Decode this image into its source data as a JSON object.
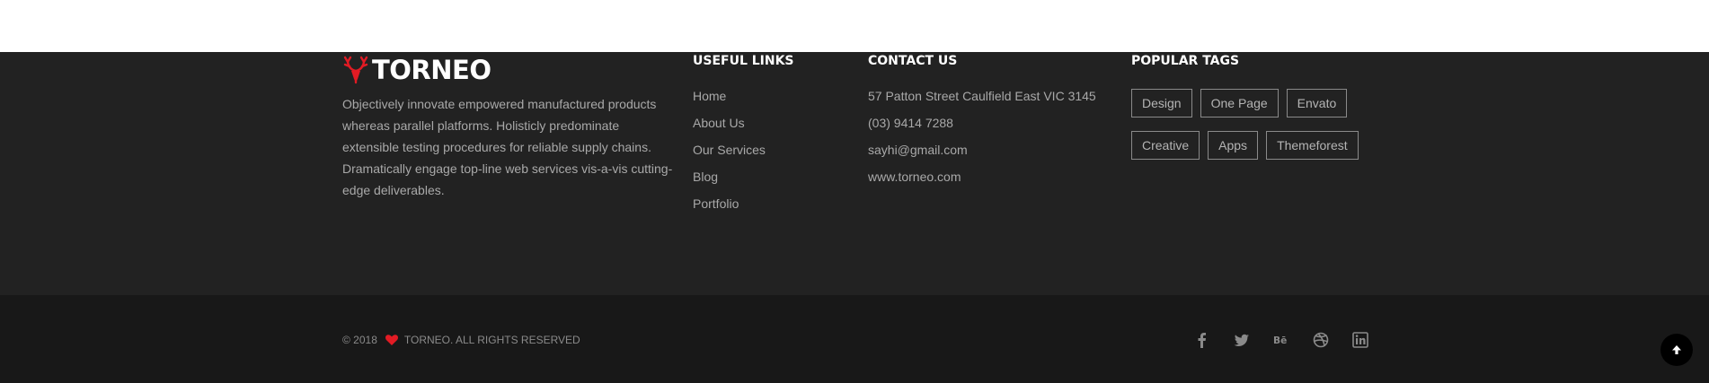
{
  "brand": {
    "name": "TORNEO",
    "accent": "#e21b24"
  },
  "about": {
    "text": "Objectively innovate empowered manufactured products whereas parallel platforms. Holisticly predominate extensible testing procedures for reliable supply chains. Dramatically engage top-line web services vis-a-vis cutting-edge deliverables."
  },
  "useful_links": {
    "title": "USEFUL LINKS",
    "items": [
      "Home",
      "About Us",
      "Our Services",
      "Blog",
      "Portfolio"
    ]
  },
  "contact": {
    "title": "CONTACT US",
    "address": "57 Patton Street Caulfield East VIC 3145",
    "phone": "(03) 9414 7288",
    "email": "sayhi@gmail.com",
    "website": "www.torneo.com"
  },
  "popular_tags": {
    "title": "POPULAR TAGS",
    "row1": [
      "Design",
      "One Page",
      "Envato"
    ],
    "row2": [
      "Creative",
      "Apps",
      "Themeforest"
    ]
  },
  "copyright": {
    "year": "© 2018",
    "text": "TORNEO. ALL RIGHTS RESERVED"
  },
  "social": [
    "facebook-icon",
    "twitter-icon",
    "behance-icon",
    "dribbble-icon",
    "linkedin-icon"
  ],
  "colors": {
    "footer_bg": "#222222",
    "bottom_bg": "#181818",
    "text_muted": "#a9a9a9"
  }
}
